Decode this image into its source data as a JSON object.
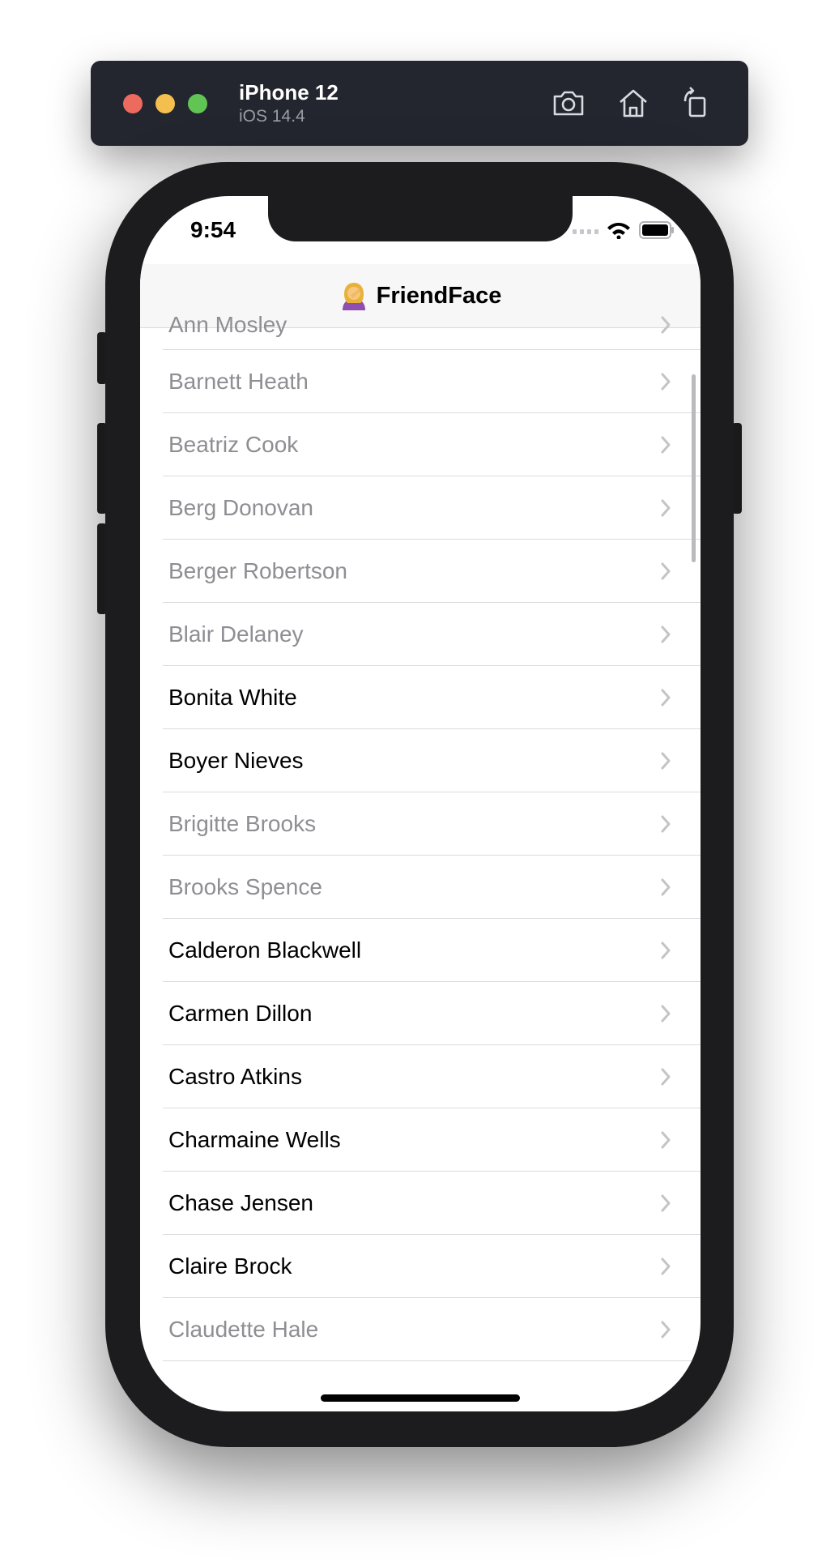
{
  "simulator": {
    "device": "iPhone 12",
    "os": "iOS 14.4",
    "buttons": [
      "screenshot-icon",
      "home-icon",
      "rotate-icon"
    ]
  },
  "status_bar": {
    "time": "9:54"
  },
  "nav": {
    "title": "FriendFace",
    "emoji_icon": "woman-facepalming-emoji"
  },
  "friends": [
    {
      "name": "Ann Mosley",
      "active": false
    },
    {
      "name": "Barnett Heath",
      "active": false
    },
    {
      "name": "Beatriz Cook",
      "active": false
    },
    {
      "name": "Berg Donovan",
      "active": false
    },
    {
      "name": "Berger Robertson",
      "active": false
    },
    {
      "name": "Blair Delaney",
      "active": false
    },
    {
      "name": "Bonita White",
      "active": true
    },
    {
      "name": "Boyer Nieves",
      "active": true
    },
    {
      "name": "Brigitte Brooks",
      "active": false
    },
    {
      "name": "Brooks Spence",
      "active": false
    },
    {
      "name": "Calderon Blackwell",
      "active": true
    },
    {
      "name": "Carmen Dillon",
      "active": true
    },
    {
      "name": "Castro Atkins",
      "active": true
    },
    {
      "name": "Charmaine Wells",
      "active": true
    },
    {
      "name": "Chase Jensen",
      "active": true
    },
    {
      "name": "Claire Brock",
      "active": true
    },
    {
      "name": "Claudette Hale",
      "active": false
    }
  ],
  "colors": {
    "active_text": "#000000",
    "inactive_text": "#8e8e93",
    "chevron": "#c4c4c7"
  }
}
